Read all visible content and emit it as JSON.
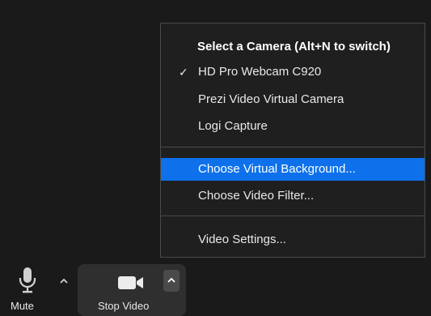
{
  "camera_menu": {
    "header": "Select a Camera (Alt+N to switch)",
    "cameras": [
      {
        "label": "HD Pro Webcam C920",
        "checked": true
      },
      {
        "label": "Prezi Video Virtual Camera",
        "checked": false
      },
      {
        "label": "Logi Capture",
        "checked": false
      }
    ],
    "check_glyph": "✓",
    "actions": [
      {
        "label": "Choose Virtual Background...",
        "highlighted": true
      },
      {
        "label": "Choose Video Filter...",
        "highlighted": false
      }
    ],
    "settings": {
      "label": "Video Settings..."
    }
  },
  "toolbar": {
    "mute": {
      "label": "Mute",
      "icon": "microphone-icon"
    },
    "mute_options": {
      "icon": "caret-up-icon"
    },
    "stop_video": {
      "label": "Stop Video",
      "icon": "video-camera-icon"
    },
    "video_options": {
      "icon": "caret-up-icon"
    }
  },
  "colors": {
    "highlight": "#0e71eb",
    "menu_bg": "#1f1f1f",
    "page_bg": "#1a1a1a"
  }
}
